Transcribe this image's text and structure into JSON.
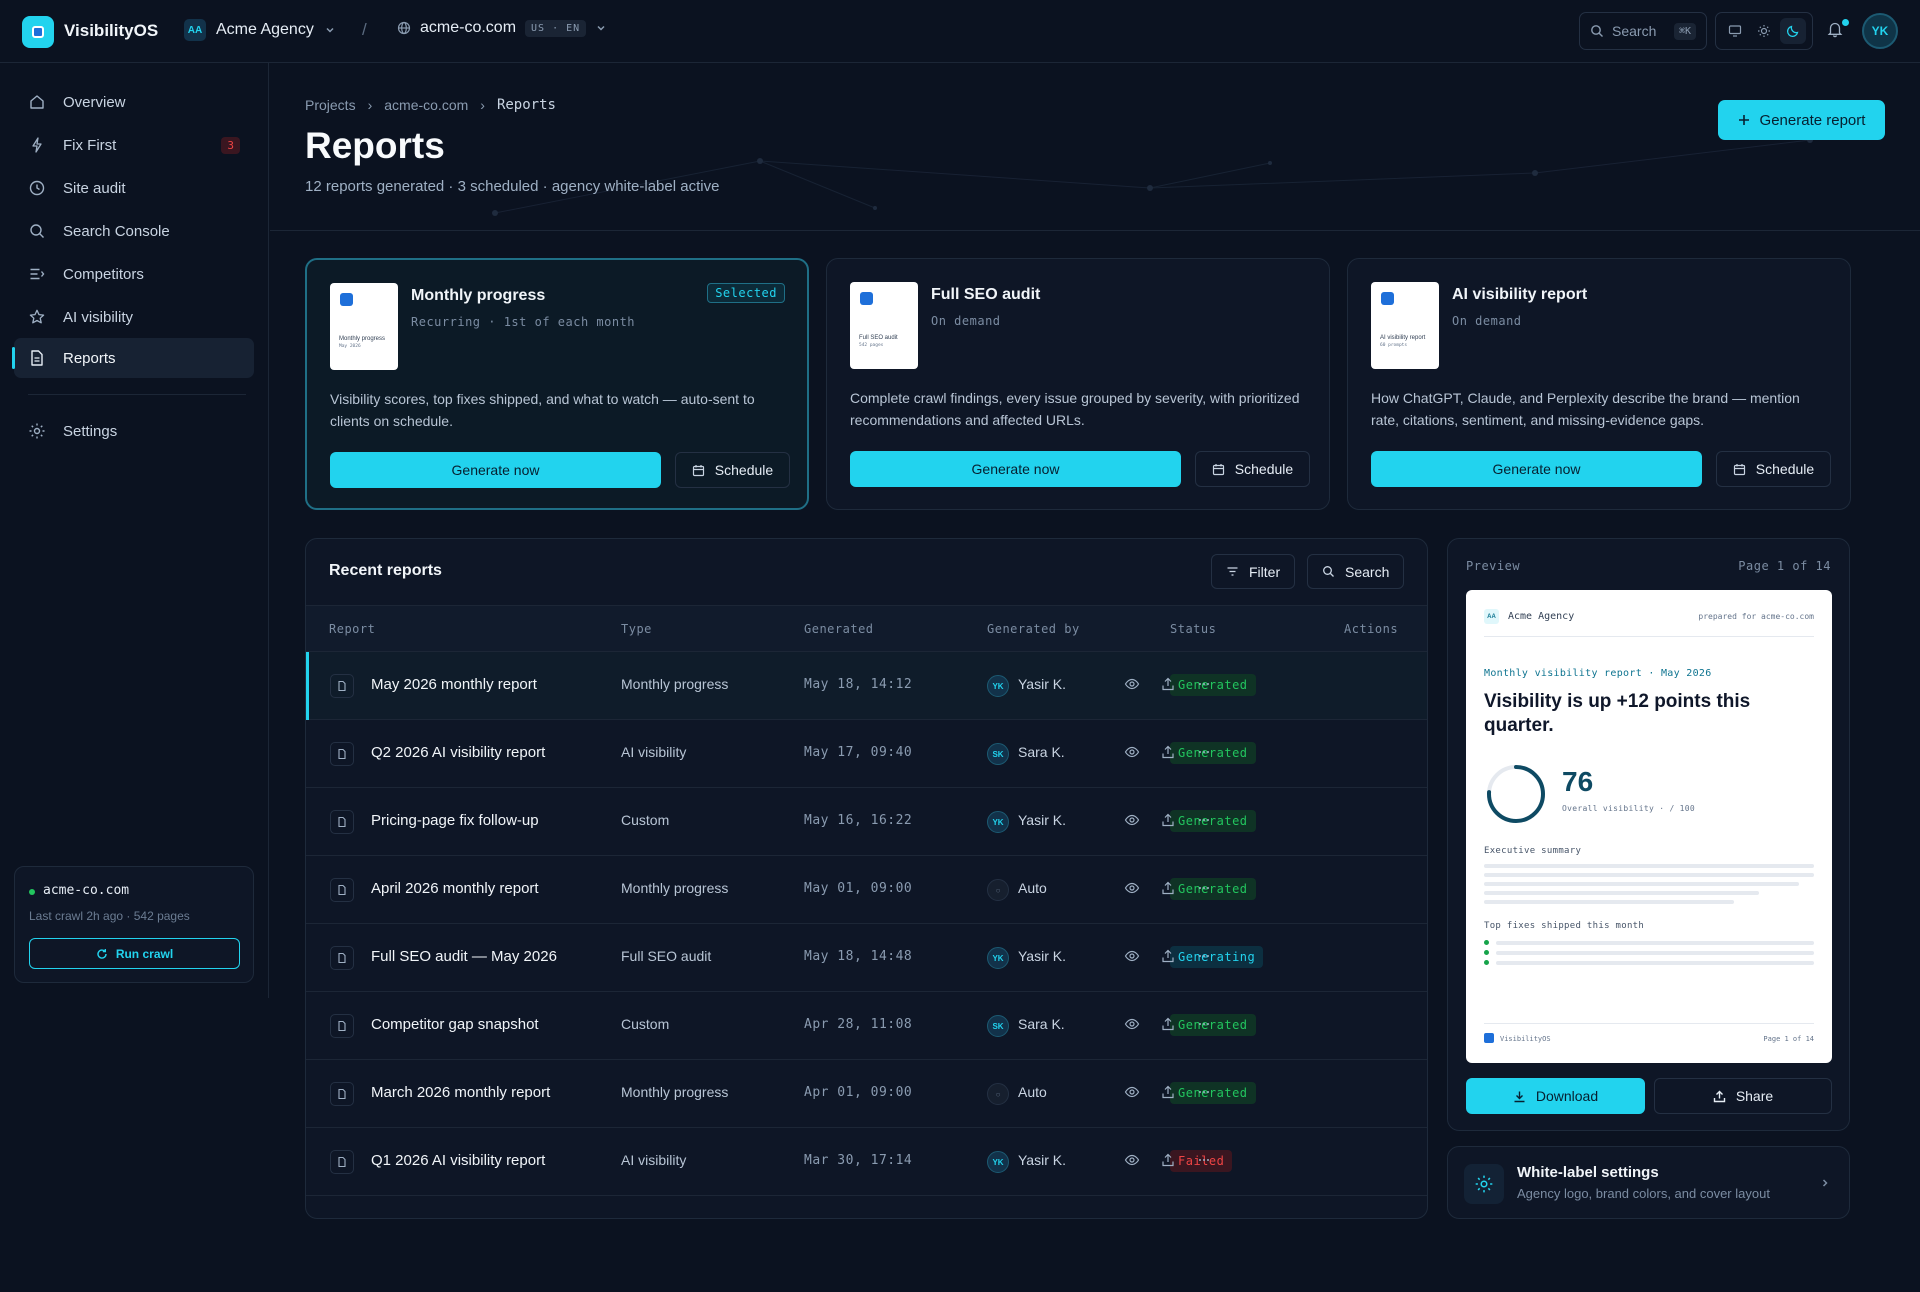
{
  "app": {
    "name": "VisibilityOS"
  },
  "org": {
    "initials": "AA",
    "name": "Acme Agency"
  },
  "project": {
    "domain": "acme-co.com",
    "locale": "US · EN"
  },
  "topbar": {
    "search_label": "Search",
    "search_shortcut": "⌘K",
    "avatar_initials": "YK",
    "theme_active": "dark"
  },
  "sidebar": {
    "items": [
      {
        "label": "Overview",
        "icon": "home-icon"
      },
      {
        "label": "Fix First",
        "icon": "bolt-icon",
        "badge": "3"
      },
      {
        "label": "Site audit",
        "icon": "clock-icon"
      },
      {
        "label": "Search Console",
        "icon": "search-icon"
      },
      {
        "label": "Competitors",
        "icon": "list-compare-icon"
      },
      {
        "label": "AI visibility",
        "icon": "star-icon"
      },
      {
        "label": "Reports",
        "icon": "document-icon",
        "active": true
      },
      {
        "label": "Settings",
        "icon": "gear-icon"
      }
    ],
    "crawl": {
      "domain": "acme-co.com",
      "meta": "Last crawl 2h ago · 542 pages",
      "button": "Run crawl"
    }
  },
  "header": {
    "breadcrumb": [
      "Projects",
      "acme-co.com",
      "Reports"
    ],
    "title": "Reports",
    "subtitle": "12 reports generated · 3 scheduled · agency white-label active",
    "generate_button": "Generate report"
  },
  "report_types": [
    {
      "title": "Monthly progress",
      "subtitle": "Recurring · 1st of each month",
      "selected": true,
      "selected_label": "Selected",
      "description": "Visibility scores, top fixes shipped, and what to watch — auto-sent to clients on schedule.",
      "thumb_title": "Monthly progress",
      "thumb_sub": "May 2026",
      "primary": "Generate now",
      "secondary": "Schedule"
    },
    {
      "title": "Full SEO audit",
      "subtitle": "On demand",
      "selected": false,
      "description": "Complete crawl findings, every issue grouped by severity, with prioritized recommendations and affected URLs.",
      "thumb_title": "Full SEO audit",
      "thumb_sub": "542 pages",
      "primary": "Generate now",
      "secondary": "Schedule"
    },
    {
      "title": "AI visibility report",
      "subtitle": "On demand",
      "selected": false,
      "description": "How ChatGPT, Claude, and Perplexity describe the brand — mention rate, citations, sentiment, and missing-evidence gaps.",
      "thumb_title": "AI visibility report",
      "thumb_sub": "60 prompts",
      "primary": "Generate now",
      "secondary": "Schedule"
    }
  ],
  "recent": {
    "title": "Recent reports",
    "filter_label": "Filter",
    "search_label": "Search",
    "columns": [
      "Report",
      "Type",
      "Generated",
      "Generated by",
      "Status",
      "Actions"
    ],
    "rows": [
      {
        "name": "May 2026 monthly report",
        "type": "Monthly progress",
        "date": "May 18, 14:12",
        "by_initials": "YK",
        "by": "Yasir K.",
        "status": "Generated",
        "selected": true
      },
      {
        "name": "Q2 2026 AI visibility report",
        "type": "AI visibility",
        "date": "May 17, 09:40",
        "by_initials": "SK",
        "by": "Sara K.",
        "status": "Generated"
      },
      {
        "name": "Pricing-page fix follow-up",
        "type": "Custom",
        "date": "May 16, 16:22",
        "by_initials": "YK",
        "by": "Yasir K.",
        "status": "Generated"
      },
      {
        "name": "April 2026 monthly report",
        "type": "Monthly progress",
        "date": "May 01, 09:00",
        "by_initials": "○",
        "by": "Auto",
        "status": "Generated"
      },
      {
        "name": "Full SEO audit — May 2026",
        "type": "Full SEO audit",
        "date": "May 18, 14:48",
        "by_initials": "YK",
        "by": "Yasir K.",
        "status": "Generating"
      },
      {
        "name": "Competitor gap snapshot",
        "type": "Custom",
        "date": "Apr 28, 11:08",
        "by_initials": "SK",
        "by": "Sara K.",
        "status": "Generated"
      },
      {
        "name": "March 2026 monthly report",
        "type": "Monthly progress",
        "date": "Apr 01, 09:00",
        "by_initials": "○",
        "by": "Auto",
        "status": "Generated"
      },
      {
        "name": "Q1 2026 AI visibility report",
        "type": "AI visibility",
        "date": "Mar 30, 17:14",
        "by_initials": "YK",
        "by": "Yasir K.",
        "status": "Failed"
      }
    ]
  },
  "preview": {
    "label": "Preview",
    "page": "Page 1 of 14",
    "doc": {
      "badge": "AA",
      "agency": "Acme Agency",
      "prepared": "prepared for acme-co.com",
      "kicker": "Monthly visibility report · May 2026",
      "headline": "Visibility is up +12 points this quarter.",
      "score": "76",
      "score_fraction": 0.76,
      "score_label": "Overall visibility · / 100",
      "summary_title": "Executive summary",
      "fixes_title": "Top fixes shipped this month",
      "footer_brand": "VisibilityOS",
      "footer_page": "Page 1 of 14"
    },
    "download": "Download",
    "share": "Share"
  },
  "white_label": {
    "title": "White-label settings",
    "subtitle": "Agency logo, brand colors, and cover layout"
  }
}
